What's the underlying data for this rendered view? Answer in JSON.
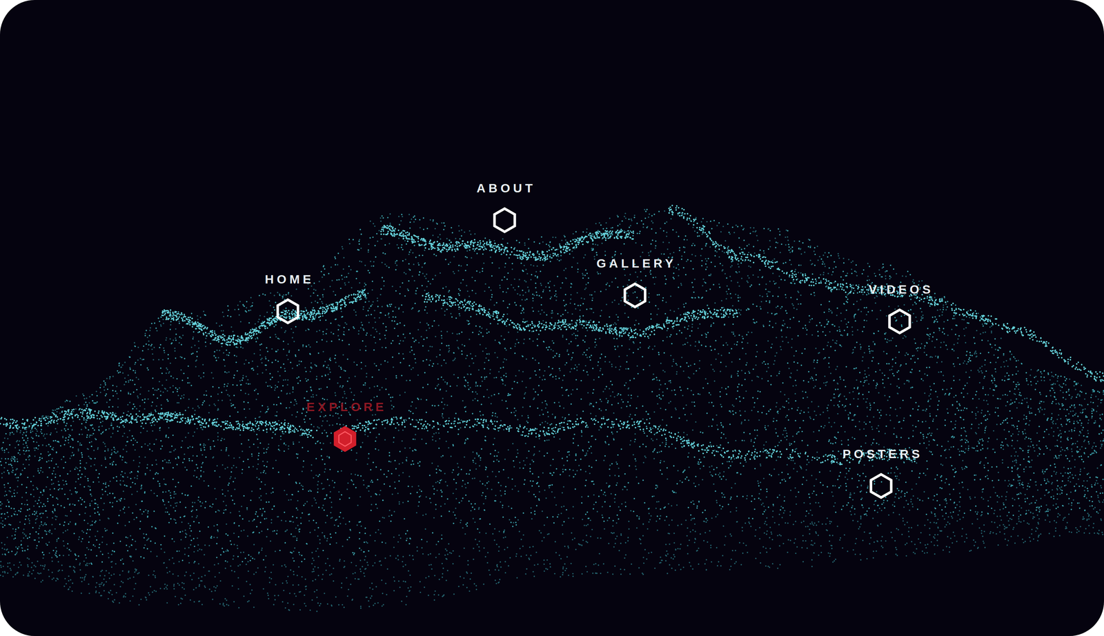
{
  "nav": [
    {
      "label": "ABOUT",
      "selected": false
    },
    {
      "label": "HOME",
      "selected": false
    },
    {
      "label": "GALLERY",
      "selected": false
    },
    {
      "label": "VIDEOS",
      "selected": false
    },
    {
      "label": "EXPLORE",
      "selected": true
    },
    {
      "label": "POSTERS",
      "selected": false
    }
  ]
}
